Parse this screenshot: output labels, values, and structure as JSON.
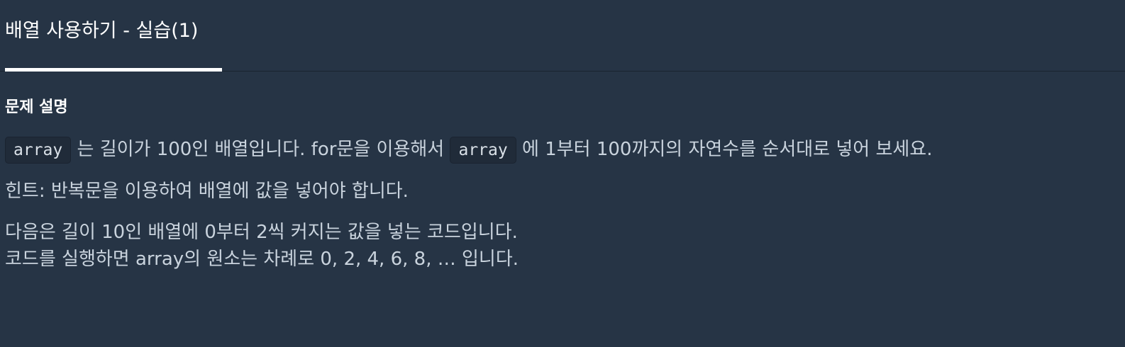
{
  "tab": {
    "title": "배열 사용하기 - 실습(1)"
  },
  "problem": {
    "heading": "문제 설명",
    "line1": {
      "code1": "array",
      "text1": " 는 길이가 100인 배열입니다. for문을 이용해서 ",
      "code2": "array",
      "text2": " 에 1부터 100까지의 자연수를 순서대로 넣어 보세요."
    },
    "hint": "힌트: 반복문을 이용하여 배열에 값을 넣어야 합니다.",
    "example_line1": "다음은 길이 10인 배열에 0부터 2씩 커지는 값을 넣는 코드입니다.",
    "example_line2": "코드를 실행하면 array의 원소는 차례로 0, 2, 4, 6, 8, … 입니다."
  }
}
